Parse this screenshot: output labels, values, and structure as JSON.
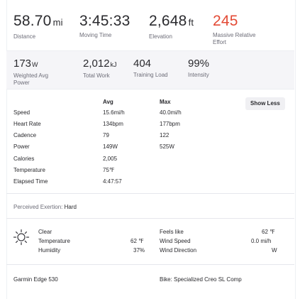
{
  "primary_stats": [
    {
      "value": "58.70",
      "unit": "mi",
      "label": "Distance"
    },
    {
      "value": "3:45:33",
      "unit": "",
      "label": "Moving Time"
    },
    {
      "value": "2,648",
      "unit": "ft",
      "label": "Elevation"
    },
    {
      "value": "245",
      "unit": "",
      "label_line1": "Massive Relative",
      "label_line2": "Effort"
    }
  ],
  "secondary_stats": [
    {
      "value": "173",
      "unit": "W",
      "label_line1": "Weighted Avg",
      "label_line2": "Power"
    },
    {
      "value": "2,012",
      "unit": "kJ",
      "label": "Total Work"
    },
    {
      "value": "404",
      "unit": "",
      "label": "Training Load"
    },
    {
      "value": "99%",
      "unit": "",
      "label": "Intensity"
    }
  ],
  "table": {
    "header_avg": "Avg",
    "header_max": "Max",
    "show_less": "Show Less",
    "rows": [
      {
        "name": "Speed",
        "avg": "15.6mi/h",
        "max": "40.0mi/h"
      },
      {
        "name": "Heart Rate",
        "avg": "134bpm",
        "max": "177bpm"
      },
      {
        "name": "Cadence",
        "avg": "79",
        "max": "122"
      },
      {
        "name": "Power",
        "avg": "149W",
        "max": "525W"
      },
      {
        "name": "Calories",
        "avg": "2,005",
        "max": ""
      },
      {
        "name": "Temperature",
        "avg": "75℉",
        "max": ""
      },
      {
        "name": "Elapsed Time",
        "avg": "4:47:57",
        "max": ""
      }
    ]
  },
  "exertion": {
    "label": "Perceived Exertion:",
    "value": "Hard"
  },
  "weather": {
    "condition": "Clear",
    "temperature_label": "Temperature",
    "temperature_value": "62 ℉",
    "humidity_label": "Humidity",
    "humidity_value": "37%",
    "feels_like_label": "Feels like",
    "feels_like_value": "62 ℉",
    "wind_speed_label": "Wind Speed",
    "wind_speed_value": "0.0 mi/h",
    "wind_direction_label": "Wind Direction",
    "wind_direction_value": "W"
  },
  "device": "Garmin Edge 530",
  "bike": "Bike: Specialized Creo SL Comp",
  "colors": {
    "accent_red": "#e34a35",
    "band_bg": "#f5f5f8"
  }
}
